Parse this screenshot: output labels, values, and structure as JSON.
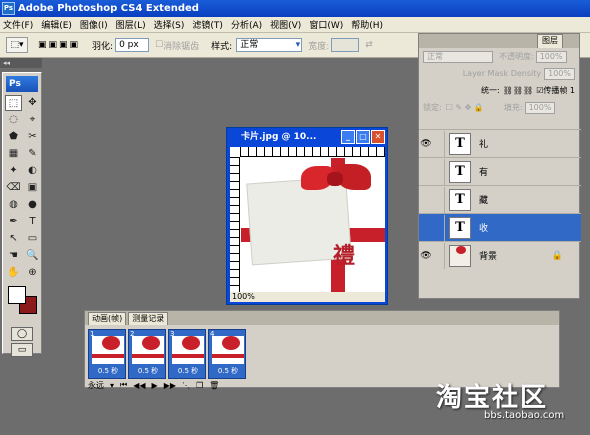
{
  "app": {
    "title": "Adobe Photoshop CS4 Extended",
    "icon_label": "Ps"
  },
  "menu": [
    "文件(F)",
    "编辑(E)",
    "图像(I)",
    "图层(L)",
    "选择(S)",
    "滤镜(T)",
    "分析(A)",
    "视图(V)",
    "窗口(W)",
    "帮助(H)"
  ],
  "options": {
    "feather_label": "羽化:",
    "feather_value": "0 px",
    "antialias_label": "消除锯齿",
    "style_label": "样式:",
    "style_value": "正常",
    "width_label": "宽度:"
  },
  "toolbox": {
    "logo": "Ps",
    "tools": [
      "⬚",
      "✥",
      "◌",
      "⌖",
      "⬟",
      "✂",
      "▦",
      "✎",
      "✦",
      "◐",
      "⌫",
      "▣",
      "◍",
      "●",
      "✒",
      "T",
      "↖",
      "▭",
      "☚",
      "🔍",
      "✋",
      "⊕"
    ]
  },
  "document": {
    "title": "卡片.jpg @ 10...",
    "zoom": "100%",
    "image_char": "禮"
  },
  "layers_panel": {
    "tab": "图层",
    "blend_mode": "正常",
    "opacity_label": "不透明度:",
    "opacity_value": "100%",
    "layer_mask_density": "Layer Mask Density",
    "density_value": "100%",
    "unify_label": "统一:",
    "propagate_label": "传播帧 1",
    "lock_label": "锁定:",
    "fill_label": "填充:",
    "fill_value": "100%",
    "layers": [
      {
        "name": "礼",
        "thumb": "T",
        "visible": true,
        "selected": false
      },
      {
        "name": "有",
        "thumb": "T",
        "visible": false,
        "selected": false
      },
      {
        "name": "藏",
        "thumb": "T",
        "visible": false,
        "selected": false
      },
      {
        "name": "收",
        "thumb": "T",
        "visible": false,
        "selected": true
      },
      {
        "name": "背景",
        "thumb": "",
        "visible": true,
        "selected": false
      }
    ]
  },
  "animation_panel": {
    "tabs": [
      "动画(帧)",
      "测量记录"
    ],
    "frames": [
      {
        "n": "1",
        "delay": "0.5 秒"
      },
      {
        "n": "2",
        "delay": "0.5 秒"
      },
      {
        "n": "3",
        "delay": "0.5 秒"
      },
      {
        "n": "4",
        "delay": "0.5 秒"
      }
    ],
    "loop_value": "永远"
  },
  "watermark": {
    "text": "淘宝社区",
    "url": "bbs.taobao.com"
  },
  "colors": {
    "accent": "#3169c6",
    "ribbon": "#c8202a",
    "titlebar": "#0a46d8"
  }
}
